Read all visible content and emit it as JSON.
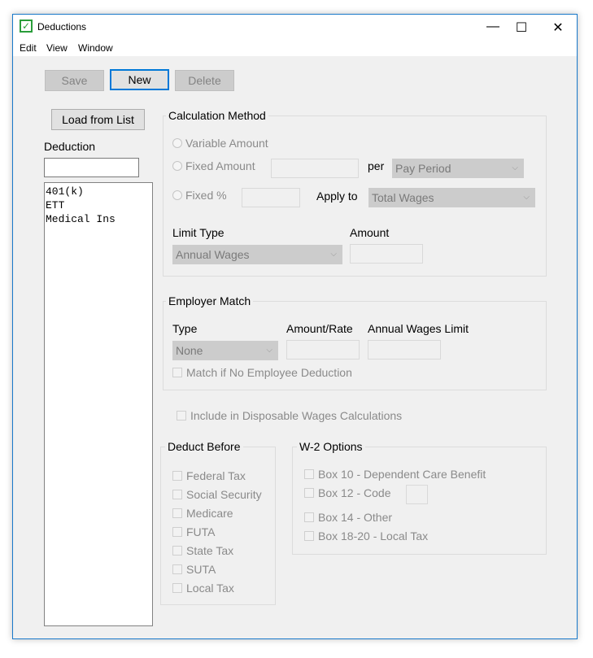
{
  "window": {
    "title": "Deductions",
    "icon": "checklist-app-icon",
    "controls": [
      "minimize",
      "maximize",
      "close"
    ]
  },
  "menu": [
    "Edit",
    "View",
    "Window"
  ],
  "toolbar": {
    "save": "Save",
    "new": "New",
    "delete": "Delete"
  },
  "left": {
    "load_button": "Load from List",
    "deduction_label": "Deduction",
    "deduction_value": "",
    "items": [
      "401(k)",
      "ETT",
      "Medical Ins"
    ]
  },
  "calc": {
    "title": "Calculation Method",
    "variable": "Variable Amount",
    "fixed_amount": "Fixed Amount",
    "per": "per",
    "per_value": "Pay Period",
    "fixed_pct": "Fixed %",
    "apply_to": "Apply to",
    "apply_value": "Total Wages",
    "limit_type": "Limit Type",
    "limit_value": "Annual Wages",
    "amount": "Amount"
  },
  "match": {
    "title": "Employer Match",
    "type": "Type",
    "type_value": "None",
    "amount_rate": "Amount/Rate",
    "wages_limit": "Annual Wages Limit",
    "no_emp": "Match if No Employee Deduction"
  },
  "disposable": "Include in Disposable Wages Calculations",
  "before": {
    "title": "Deduct Before",
    "items": [
      "Federal Tax",
      "Social Security",
      "Medicare",
      "FUTA",
      "State Tax",
      "SUTA",
      "Local Tax"
    ]
  },
  "w2": {
    "title": "W-2 Options",
    "items": [
      "Box 10 - Dependent Care Benefit",
      "Box 12 - Code",
      "Box 14 - Other",
      "Box 18-20 - Local Tax"
    ]
  }
}
